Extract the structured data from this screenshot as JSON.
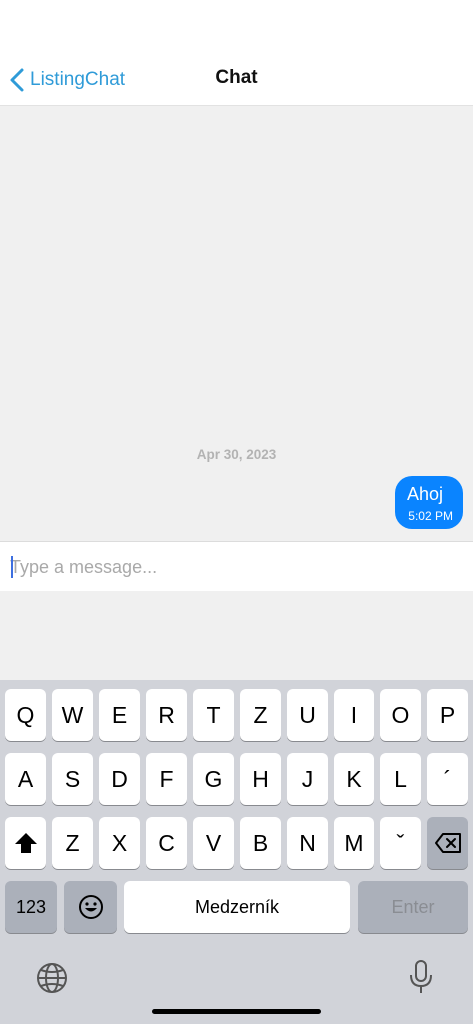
{
  "navbar": {
    "back_label": "ListingChat",
    "title": "Chat"
  },
  "chat": {
    "date_separator": "Apr 30, 2023",
    "messages": [
      {
        "text": "Ahoj",
        "time": "5:02 PM",
        "direction": "outgoing"
      }
    ]
  },
  "composer": {
    "placeholder": "Type a message...",
    "value": ""
  },
  "keyboard": {
    "row1": [
      "Q",
      "W",
      "E",
      "R",
      "T",
      "Z",
      "U",
      "I",
      "O",
      "P"
    ],
    "row2": [
      "A",
      "S",
      "D",
      "F",
      "G",
      "H",
      "J",
      "K",
      "L",
      "´"
    ],
    "row3": [
      "Z",
      "X",
      "C",
      "V",
      "B",
      "N",
      "M",
      "ˇ"
    ],
    "numbers_key": "123",
    "space_label": "Medzerník",
    "enter_label": "Enter",
    "shift_icon": "shift-icon",
    "delete_icon": "backspace-icon",
    "emoji_icon": "emoji-icon",
    "globe_icon": "globe-icon",
    "mic_icon": "microphone-icon"
  },
  "colors": {
    "accent": "#2f9bd8",
    "bubble": "#0a84ff",
    "chat_background": "#f0f0f0",
    "keyboard_background": "#d1d3d9"
  }
}
